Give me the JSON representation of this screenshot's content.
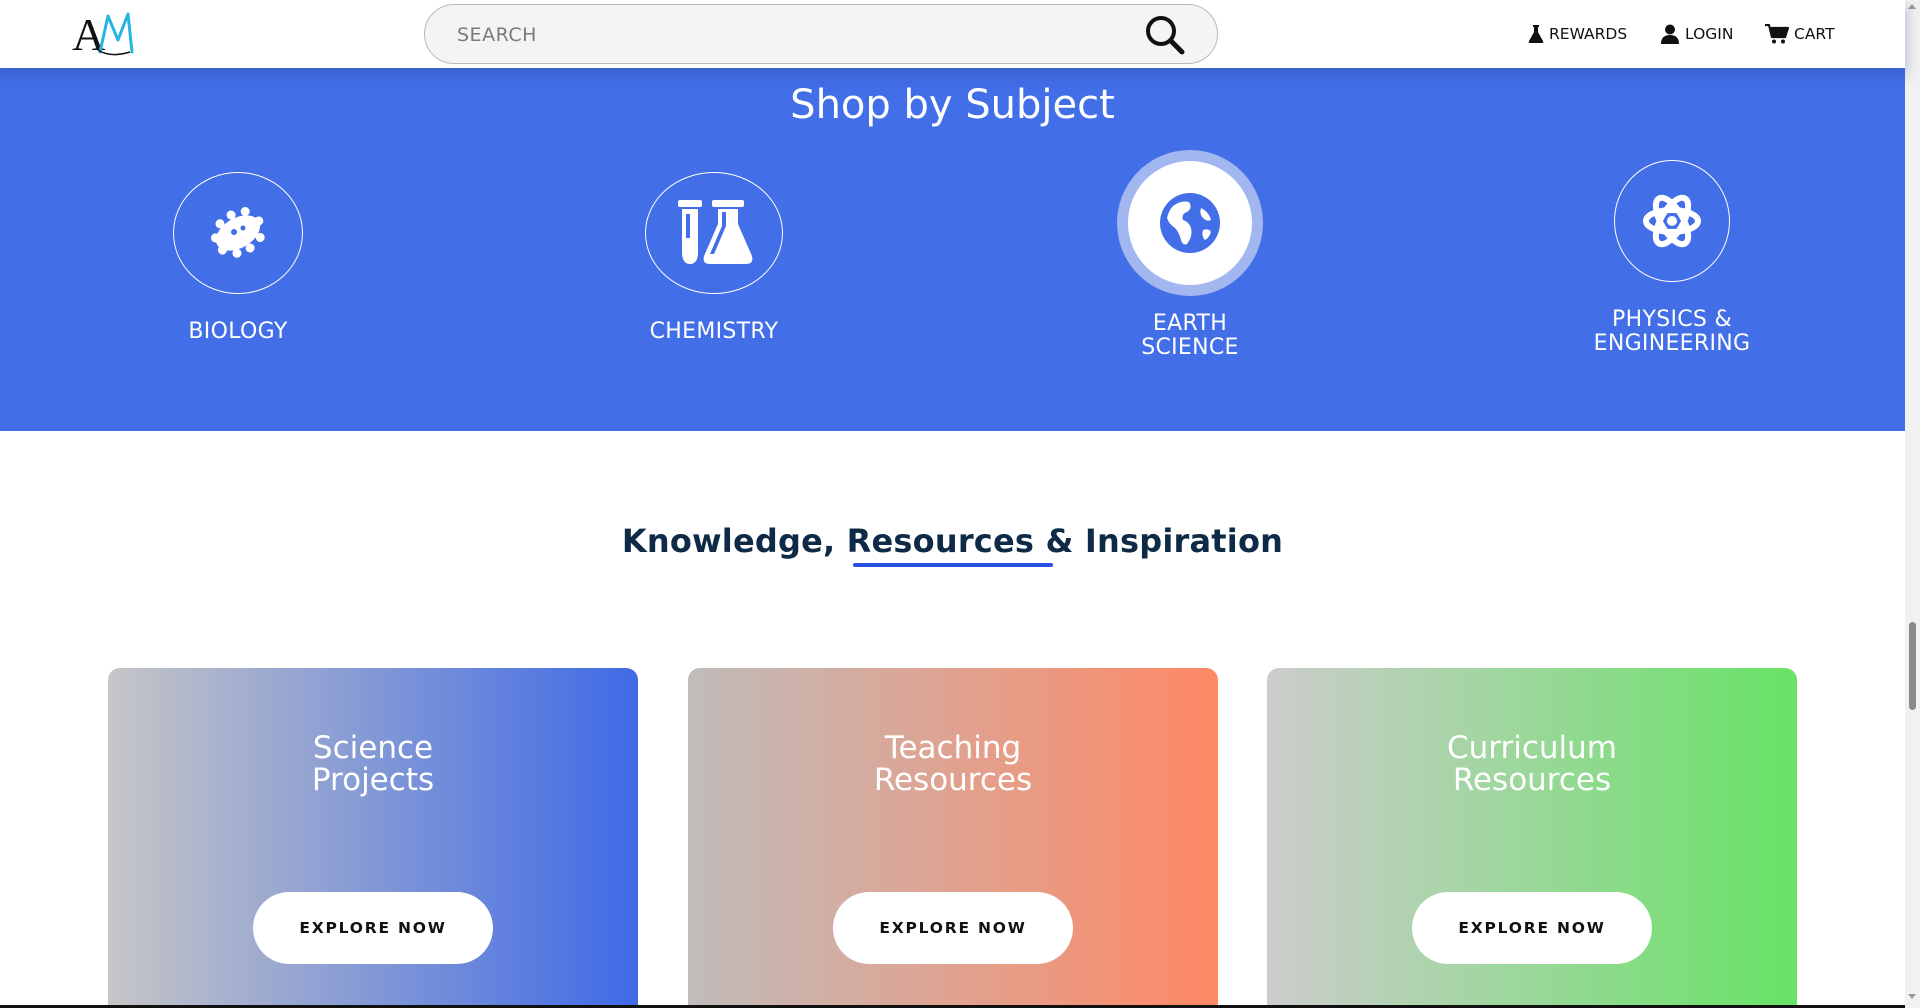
{
  "header": {
    "logo_text": "AM",
    "search_placeholder": "SEARCH",
    "nav": {
      "rewards": "REWARDS",
      "login": "LOGIN",
      "cart": "CART"
    }
  },
  "subjects": {
    "title": "Shop by Subject",
    "items": [
      {
        "label": "BIOLOGY",
        "icon": "virus-icon"
      },
      {
        "label": "CHEMISTRY",
        "icon": "flask-icon"
      },
      {
        "label_line1": "EARTH",
        "label_line2": "SCIENCE",
        "icon": "globe-icon"
      },
      {
        "label_line1": "PHYSICS &",
        "label_line2": "ENGINEERING",
        "icon": "atom-icon"
      }
    ]
  },
  "knowledge": {
    "title": "Knowledge, Resources & Inspiration",
    "cards": [
      {
        "title_line1": "Science",
        "title_line2": "Projects",
        "button": "EXPLORE NOW"
      },
      {
        "title_line1": "Teaching",
        "title_line2": "Resources",
        "button": "EXPLORE NOW"
      },
      {
        "title_line1": "Curriculum",
        "title_line2": "Resources",
        "button": "EXPLORE NOW"
      }
    ]
  },
  "colors": {
    "band": "#426ee8",
    "heading": "#0e2a47",
    "underline": "#2651e3"
  }
}
